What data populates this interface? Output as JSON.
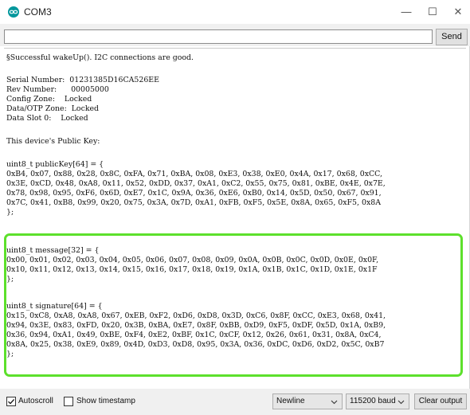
{
  "window": {
    "title": "COM3",
    "minimize_glyph": "—",
    "maximize_glyph": "☐",
    "close_glyph": "✕"
  },
  "toolbar": {
    "input_value": "",
    "send_label": "Send"
  },
  "output_lines": [
    "§Successful wakeUp(). I2C connections are good.",
    "",
    "Serial Number:  01231385D16CA526EE",
    "Rev Number:      00005000",
    "Config Zone:    Locked",
    "Data/OTP Zone:  Locked",
    "Data Slot 0:    Locked",
    "",
    "This device's Public Key:",
    "",
    "uint8_t publicKey[64] = {",
    "0xB4, 0x07, 0x88, 0x28, 0x8C, 0xFA, 0x71, 0xBA, 0x08, 0xE3, 0x38, 0xE0, 0x4A, 0x17, 0x68, 0xCC,",
    "0x3E, 0xCD, 0x48, 0xA8, 0x11, 0x52, 0xDD, 0x37, 0xA1, 0xC2, 0x55, 0x75, 0x81, 0xBE, 0x4E, 0x7E,",
    "0x78, 0x98, 0x95, 0xF6, 0x6D, 0xE7, 0x1C, 0x9A, 0x36, 0xE6, 0xB0, 0x14, 0x5D, 0x50, 0x67, 0x91,",
    "0x7C, 0x41, 0xB8, 0x99, 0x20, 0x75, 0x3A, 0x7D, 0xA1, 0xFB, 0xF5, 0x5E, 0x8A, 0x65, 0xF5, 0x8A",
    "};",
    "",
    "uint8_t message[32] = {",
    "0x00, 0x01, 0x02, 0x03, 0x04, 0x05, 0x06, 0x07, 0x08, 0x09, 0x0A, 0x0B, 0x0C, 0x0D, 0x0E, 0x0F,",
    "0x10, 0x11, 0x12, 0x13, 0x14, 0x15, 0x16, 0x17, 0x18, 0x19, 0x1A, 0x1B, 0x1C, 0x1D, 0x1E, 0x1F",
    "};",
    "",
    "uint8_t signature[64] = {",
    "0x15, 0xC8, 0xA8, 0xA8, 0x67, 0xEB, 0xF2, 0xD6, 0xD8, 0x3D, 0xC6, 0x8F, 0xCC, 0xE3, 0x68, 0x41,",
    "0x94, 0x3E, 0x83, 0xFD, 0x20, 0x3B, 0xBA, 0xE7, 0x8F, 0xBB, 0xD9, 0xF5, 0xDF, 0x5D, 0x1A, 0xB9,",
    "0x36, 0x94, 0xA1, 0x49, 0xBE, 0xF4, 0xE2, 0xBF, 0x1C, 0xCF, 0x12, 0x26, 0x61, 0x31, 0x8A, 0xC4,",
    "0x8A, 0x25, 0x38, 0xE9, 0x89, 0x4D, 0xD3, 0xD8, 0x95, 0x3A, 0x36, 0xDC, 0xD6, 0xD2, 0x5C, 0xB7",
    "};"
  ],
  "footer": {
    "autoscroll_label": "Autoscroll",
    "autoscroll_checked": true,
    "timestamp_label": "Show timestamp",
    "timestamp_checked": false,
    "line_ending": "Newline",
    "baud_rate": "115200 baud",
    "clear_label": "Clear output"
  },
  "colors": {
    "highlight": "#5de02c",
    "app_icon": "#00979c"
  },
  "icons": {
    "app": "arduino-logo-icon",
    "chevron": "chevron-down-icon",
    "check": "checkmark-icon"
  }
}
